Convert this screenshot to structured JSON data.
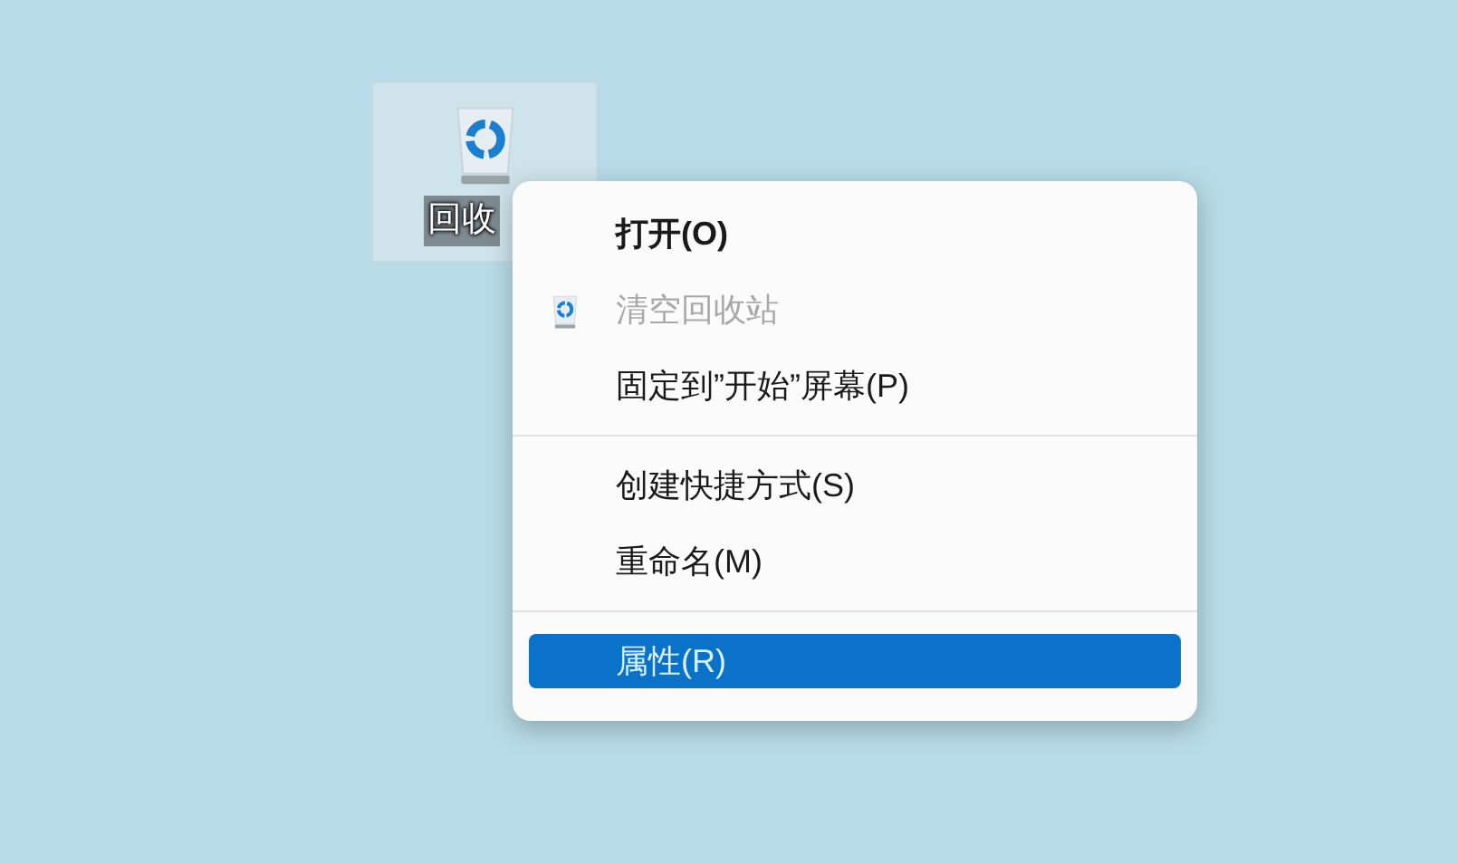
{
  "desktop_icon": {
    "label": "回收",
    "selected": true
  },
  "context_menu": {
    "items": [
      {
        "kind": "item",
        "label": "打开(O)",
        "bold": true,
        "disabled": false,
        "has_icon": false,
        "selected": false
      },
      {
        "kind": "item",
        "label": "清空回收站",
        "bold": false,
        "disabled": true,
        "has_icon": true,
        "selected": false
      },
      {
        "kind": "item",
        "label": "固定到”开始”屏幕(P)",
        "bold": false,
        "disabled": false,
        "has_icon": false,
        "selected": false
      },
      {
        "kind": "separator"
      },
      {
        "kind": "item",
        "label": "创建快捷方式(S)",
        "bold": false,
        "disabled": false,
        "has_icon": false,
        "selected": false
      },
      {
        "kind": "item",
        "label": "重命名(M)",
        "bold": false,
        "disabled": false,
        "has_icon": false,
        "selected": false
      },
      {
        "kind": "separator"
      },
      {
        "kind": "item",
        "label": "属性(R)",
        "bold": false,
        "disabled": false,
        "has_icon": false,
        "selected": true
      }
    ]
  }
}
